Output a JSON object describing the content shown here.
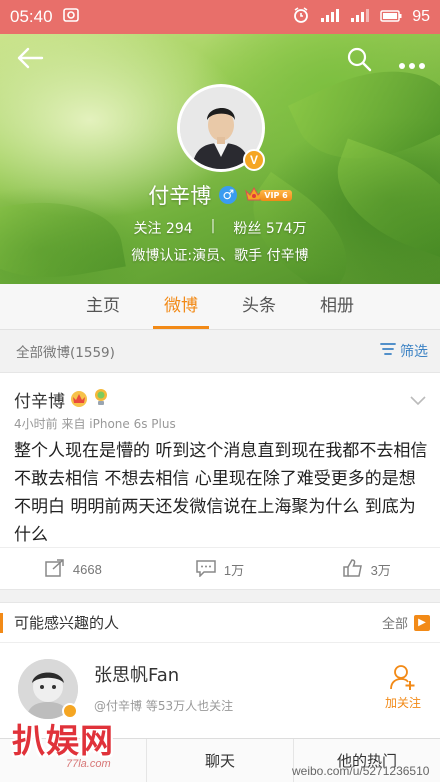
{
  "status_bar": {
    "time": "05:40",
    "battery": "95"
  },
  "profile": {
    "name": "付辛博",
    "verified_badge": "V",
    "vip_label": "VIP 6",
    "following_label": "关注",
    "following_count": "294",
    "fans_label": "粉丝",
    "fans_count": "574万",
    "verification": "微博认证:演员、歌手 付辛博"
  },
  "tabs": [
    {
      "label": "主页",
      "active": false
    },
    {
      "label": "微博",
      "active": true
    },
    {
      "label": "头条",
      "active": false
    },
    {
      "label": "相册",
      "active": false
    }
  ],
  "filter": {
    "all_posts": "全部微博(1559)",
    "filter_label": "筛选"
  },
  "post": {
    "author": "付辛博",
    "meta": "4小时前  来自 iPhone 6s Plus",
    "text": "整个人现在是懵的 听到这个消息直到现在我都不去相信 不敢去相信 不想去相信 心里现在除了难受更多的是想不明白 明明前两天还发微信说在上海聚为什么 到底为什么",
    "repost_count": "4668",
    "comment_count": "1万",
    "like_count": "3万"
  },
  "suggestions": {
    "title": "可能感兴趣的人",
    "all_label": "全部",
    "user_name": "张思帆Fan",
    "user_desc": "@付辛博 等53万人也关注",
    "follow_label": "加关注"
  },
  "bottom_bar": {
    "chat": "聊天",
    "hot": "他的热门"
  },
  "watermarks": {
    "logo_text": "扒娱网",
    "logo_sub": "77la.com",
    "url": "weibo.com/u/5271236510"
  },
  "colors": {
    "accent": "#f28a17",
    "status_bar": "#e86f6a",
    "link_blue": "#3b82c4"
  }
}
